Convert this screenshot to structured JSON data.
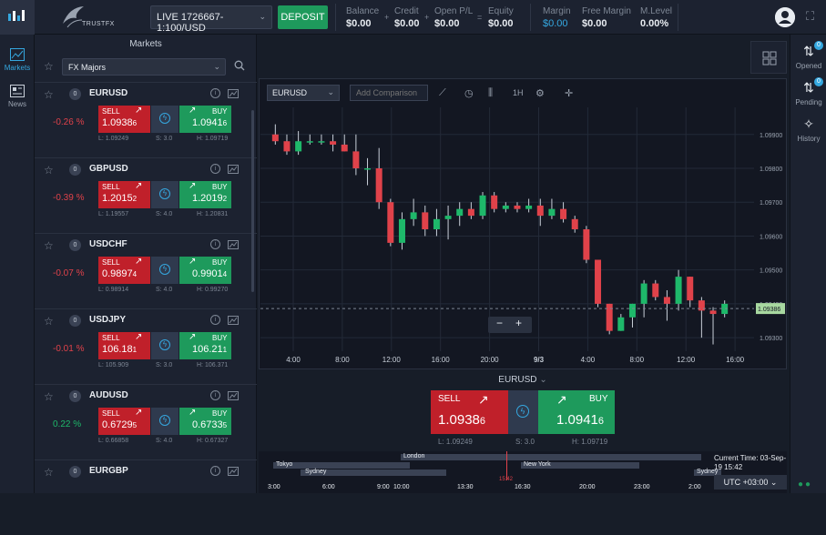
{
  "brand": {
    "name": "TRUSTFX"
  },
  "topbar": {
    "account": "LIVE 1726667-1:100/USD",
    "deposit_label": "DEPOSIT",
    "stats": [
      {
        "label": "Balance",
        "value": "$0.00"
      },
      {
        "label": "Credit",
        "value": "$0.00"
      },
      {
        "label": "Open P/L",
        "value": "$0.00"
      },
      {
        "label": "Equity",
        "value": "$0.00"
      },
      {
        "label": "Margin",
        "value": "$0.00"
      },
      {
        "label": "Free Margin",
        "value": "$0.00"
      },
      {
        "label": "M.Level",
        "value": "0.00%"
      }
    ],
    "ops": [
      "+",
      "+",
      "="
    ]
  },
  "leftnav": [
    {
      "label": "Markets",
      "icon": "chart-icon"
    },
    {
      "label": "News",
      "icon": "news-icon"
    }
  ],
  "markets": {
    "title": "Markets",
    "filter": "FX Majors",
    "instruments": [
      {
        "symbol": "EURUSD",
        "count": "0",
        "change": "-0.26 %",
        "change_color": "#e0424a",
        "sell_label": "SELL",
        "sell_main": "1.0938",
        "sell_pip": "6",
        "buy_label": "BUY",
        "buy_main": "1.0941",
        "buy_pip": "6",
        "low": "L: 1.09249",
        "spread": "S: 3.0",
        "high": "H: 1.09719"
      },
      {
        "symbol": "GBPUSD",
        "count": "0",
        "change": "-0.39 %",
        "change_color": "#e0424a",
        "sell_label": "SELL",
        "sell_main": "1.2015",
        "sell_pip": "2",
        "buy_label": "BUY",
        "buy_main": "1.2019",
        "buy_pip": "2",
        "low": "L: 1.19557",
        "spread": "S: 4.0",
        "high": "H: 1.20831"
      },
      {
        "symbol": "USDCHF",
        "count": "0",
        "change": "-0.07 %",
        "change_color": "#e0424a",
        "sell_label": "SELL",
        "sell_main": "0.9897",
        "sell_pip": "4",
        "buy_label": "BUY",
        "buy_main": "0.9901",
        "buy_pip": "4",
        "low": "L: 0.98914",
        "spread": "S: 4.0",
        "high": "H: 0.99270"
      },
      {
        "symbol": "USDJPY",
        "count": "0",
        "change": "-0.01 %",
        "change_color": "#e0424a",
        "sell_label": "SELL",
        "sell_main": "106.18",
        "sell_pip": "1",
        "buy_label": "BUY",
        "buy_main": "106.21",
        "buy_pip": "1",
        "low": "L: 105.909",
        "spread": "S: 3.0",
        "high": "H: 106.371"
      },
      {
        "symbol": "AUDUSD",
        "count": "0",
        "change": "0.22 %",
        "change_color": "#1eb86a",
        "sell_label": "SELL",
        "sell_main": "0.6729",
        "sell_pip": "5",
        "buy_label": "BUY",
        "buy_main": "0.6733",
        "buy_pip": "5",
        "low": "L: 0.66858",
        "spread": "S: 4.0",
        "high": "H: 0.67327"
      },
      {
        "symbol": "EURGBP",
        "count": "0"
      }
    ]
  },
  "chart_toolbar": {
    "symbol": "EURUSD",
    "compare_placeholder": "Add Comparison",
    "interval": "1H"
  },
  "chart_data": {
    "type": "candlestick",
    "symbol": "EURUSD",
    "ylim": [
      1.0926,
      1.0998
    ],
    "y_ticks": [
      "1.09900",
      "1.09800",
      "1.09700",
      "1.09600",
      "1.09500",
      "1.09400",
      "1.09300"
    ],
    "y_tick_values": [
      1.099,
      1.098,
      1.097,
      1.096,
      1.095,
      1.094,
      1.093
    ],
    "x_ticks": [
      "4:00",
      "8:00",
      "12:00",
      "16:00",
      "20:00",
      "9/3",
      "4:00",
      "8:00",
      "12:00",
      "16:00"
    ],
    "current_price": "1.09386",
    "current_value": 1.09386,
    "candles": [
      {
        "o": 1.099,
        "h": 1.0993,
        "l": 1.0987,
        "c": 1.0988
      },
      {
        "o": 1.0988,
        "h": 1.099,
        "l": 1.0984,
        "c": 1.0985
      },
      {
        "o": 1.0985,
        "h": 1.0991,
        "l": 1.0984,
        "c": 1.0988
      },
      {
        "o": 1.0988,
        "h": 1.099,
        "l": 1.0987,
        "c": 1.0988
      },
      {
        "o": 1.0988,
        "h": 1.099,
        "l": 1.0987,
        "c": 1.0988
      },
      {
        "o": 1.0988,
        "h": 1.099,
        "l": 1.0985,
        "c": 1.0987
      },
      {
        "o": 1.0987,
        "h": 1.099,
        "l": 1.0985,
        "c": 1.0985
      },
      {
        "o": 1.0985,
        "h": 1.099,
        "l": 1.0978,
        "c": 1.098
      },
      {
        "o": 1.098,
        "h": 1.0983,
        "l": 1.0975,
        "c": 1.098
      },
      {
        "o": 1.098,
        "h": 1.0986,
        "l": 1.0968,
        "c": 1.097
      },
      {
        "o": 1.097,
        "h": 1.0971,
        "l": 1.0957,
        "c": 1.0958
      },
      {
        "o": 1.0958,
        "h": 1.0967,
        "l": 1.0956,
        "c": 1.0965
      },
      {
        "o": 1.0965,
        "h": 1.0971,
        "l": 1.0963,
        "c": 1.0967
      },
      {
        "o": 1.0967,
        "h": 1.0969,
        "l": 1.096,
        "c": 1.0962
      },
      {
        "o": 1.0962,
        "h": 1.0968,
        "l": 1.096,
        "c": 1.0965
      },
      {
        "o": 1.0965,
        "h": 1.0969,
        "l": 1.0959,
        "c": 1.0966
      },
      {
        "o": 1.0966,
        "h": 1.097,
        "l": 1.0963,
        "c": 1.0968
      },
      {
        "o": 1.0968,
        "h": 1.097,
        "l": 1.0965,
        "c": 1.0966
      },
      {
        "o": 1.0966,
        "h": 1.0973,
        "l": 1.0965,
        "c": 1.0972
      },
      {
        "o": 1.0972,
        "h": 1.0973,
        "l": 1.0967,
        "c": 1.0968
      },
      {
        "o": 1.0968,
        "h": 1.097,
        "l": 1.0967,
        "c": 1.0969
      },
      {
        "o": 1.0969,
        "h": 1.097,
        "l": 1.0967,
        "c": 1.0968
      },
      {
        "o": 1.0968,
        "h": 1.0971,
        "l": 1.0967,
        "c": 1.0969
      },
      {
        "o": 1.0969,
        "h": 1.0971,
        "l": 1.0963,
        "c": 1.0966
      },
      {
        "o": 1.0966,
        "h": 1.0971,
        "l": 1.0965,
        "c": 1.0968
      },
      {
        "o": 1.0968,
        "h": 1.097,
        "l": 1.0964,
        "c": 1.0965
      },
      {
        "o": 1.0965,
        "h": 1.0966,
        "l": 1.0961,
        "c": 1.0962
      },
      {
        "o": 1.0962,
        "h": 1.0963,
        "l": 1.0952,
        "c": 1.0953
      },
      {
        "o": 1.0953,
        "h": 1.0953,
        "l": 1.0939,
        "c": 1.094
      },
      {
        "o": 1.094,
        "h": 1.094,
        "l": 1.0931,
        "c": 1.0932
      },
      {
        "o": 1.0932,
        "h": 1.0937,
        "l": 1.0932,
        "c": 1.0936
      },
      {
        "o": 1.0936,
        "h": 1.094,
        "l": 1.0933,
        "c": 1.094
      },
      {
        "o": 1.094,
        "h": 1.0947,
        "l": 1.0936,
        "c": 1.0946
      },
      {
        "o": 1.0946,
        "h": 1.0947,
        "l": 1.0941,
        "c": 1.0942
      },
      {
        "o": 1.0942,
        "h": 1.0944,
        "l": 1.0935,
        "c": 1.094
      },
      {
        "o": 1.094,
        "h": 1.095,
        "l": 1.0938,
        "c": 1.0948
      },
      {
        "o": 1.0948,
        "h": 1.0948,
        "l": 1.0939,
        "c": 1.0941
      },
      {
        "o": 1.0941,
        "h": 1.0942,
        "l": 1.093,
        "c": 1.0938
      },
      {
        "o": 1.0938,
        "h": 1.0939,
        "l": 1.0928,
        "c": 1.0937
      },
      {
        "o": 1.0937,
        "h": 1.0941,
        "l": 1.0936,
        "c": 1.094
      }
    ]
  },
  "trade": {
    "symbol": "EURUSD",
    "sell_label": "SELL",
    "sell_main": "1.0938",
    "sell_pip": "6",
    "buy_label": "BUY",
    "buy_main": "1.0941",
    "buy_pip": "6",
    "low": "L: 1.09249",
    "spread": "S: 3.0",
    "high": "H: 1.09719"
  },
  "rightnav": [
    {
      "label": "Opened",
      "badge": "0"
    },
    {
      "label": "Pending",
      "badge": "0"
    },
    {
      "label": "History"
    }
  ],
  "sessions": {
    "bars": [
      {
        "label": "Tokyo"
      },
      {
        "label": "Sydney"
      },
      {
        "label": "London"
      },
      {
        "label": "New York"
      },
      {
        "label": "Sydney"
      }
    ],
    "ticks": [
      "3:00",
      "6:00",
      "9:00",
      "10:00",
      "13:30",
      "16:30",
      "20:00",
      "23:00",
      "2:00"
    ],
    "now_marker": "15:42",
    "current_time": "Current Time: 03-Sep-19 15:42",
    "timezone": "UTC +03:00"
  },
  "colors": {
    "sell": "#c0202a",
    "buy": "#1e9a5c",
    "accent": "#35a8e0",
    "bull": "#1eb86a",
    "bear": "#e0424a"
  }
}
